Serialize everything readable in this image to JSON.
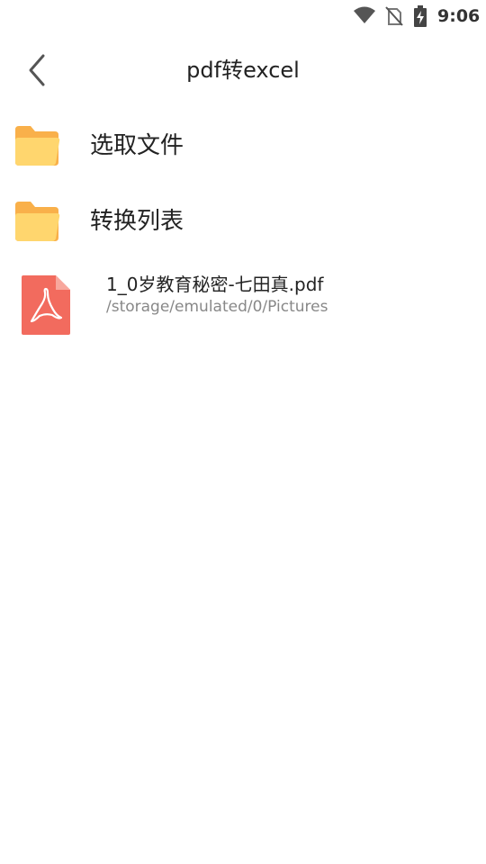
{
  "status_bar": {
    "time": "9:06",
    "icons": [
      "wifi-icon",
      "no-sim-icon",
      "battery-charging-icon"
    ]
  },
  "header": {
    "title": "pdf转excel",
    "back_icon": "chevron-left-icon"
  },
  "menu": {
    "items": [
      {
        "label": "选取文件",
        "icon": "folder-icon"
      },
      {
        "label": "转换列表",
        "icon": "folder-icon"
      }
    ]
  },
  "files": [
    {
      "name": "1_0岁教育秘密-七田真.pdf",
      "path": "/storage/emulated/0/Pictures",
      "icon": "pdf-file-icon"
    }
  ],
  "colors": {
    "folder_back": "#F9B04A",
    "folder_front": "#FFD66E",
    "pdf_red": "#F26B5E",
    "text_primary": "#222222",
    "text_secondary": "#888888"
  }
}
